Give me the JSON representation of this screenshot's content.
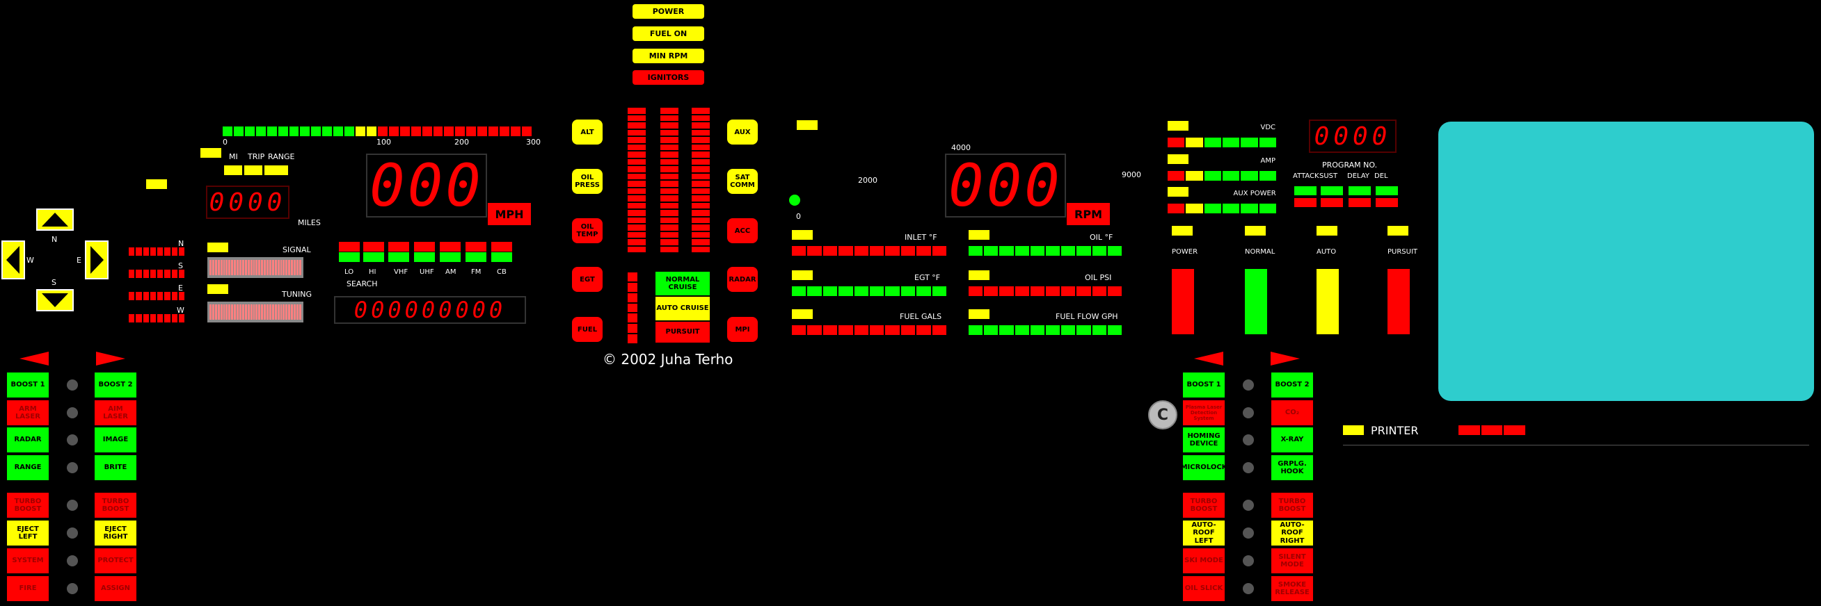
{
  "top_indicators": [
    "POWER",
    "FUEL ON",
    "MIN RPM",
    "IGNITORS"
  ],
  "compass": {
    "n": "N",
    "s": "S",
    "e": "E",
    "w": "W"
  },
  "speed": {
    "scale_labels": [
      "0",
      "100",
      "200",
      "300"
    ],
    "mode_labels": [
      "MI",
      "TRIP",
      "RANGE"
    ],
    "odometer": "0000",
    "miles_label": "MILES",
    "readout": "000",
    "unit": "MPH"
  },
  "nsew_labels": [
    "N",
    "S",
    "E",
    "W"
  ],
  "signal_label": "SIGNAL",
  "tuning_label": "TUNING",
  "bands": [
    "LO",
    "HI",
    "VHF",
    "UHF",
    "AM",
    "FM",
    "CB"
  ],
  "search_label": "SEARCH",
  "freq_readout": "000000000",
  "left_pills": [
    "ALT",
    "OIL PRESS",
    "OIL TEMP",
    "EGT",
    "FUEL"
  ],
  "right_pills": [
    "AUX",
    "SAT COMM",
    "ACC",
    "RADAR",
    "MPI"
  ],
  "cruise_modes": [
    "NORMAL CRUISE",
    "AUTO CRUISE",
    "PURSUIT"
  ],
  "copyright": "© 2002 Juha Terho",
  "rpm": {
    "scale_labels": [
      "0",
      "2000",
      "4000",
      "9000"
    ],
    "readout": "000",
    "unit": "RPM"
  },
  "gauges_left": [
    "INLET °F",
    "EGT °F",
    "FUEL GALS"
  ],
  "gauges_right": [
    "OIL °F",
    "OIL PSI",
    "FUEL FLOW GPH"
  ],
  "power_meters": [
    "VDC",
    "AMP",
    "AUX POWER"
  ],
  "program": {
    "readout": "0000",
    "label": "PROGRAM NO.",
    "columns": [
      "ATTACK",
      "SUST",
      "DELAY",
      "DEL"
    ]
  },
  "mode_columns": [
    "POWER",
    "NORMAL",
    "AUTO",
    "PURSUIT"
  ],
  "left_panel": {
    "col1": [
      "BOOST 1",
      "ARM LASER",
      "RADAR",
      "RANGE",
      "TURBO BOOST",
      "EJECT LEFT",
      "SYSTEM",
      "FIRE"
    ],
    "col2": [
      "BOOST 2",
      "AIM LASER",
      "IMAGE",
      "BRITE",
      "TURBO BOOST",
      "EJECT RIGHT",
      "PROTECT",
      "ASSIGN"
    ]
  },
  "right_panel": {
    "col1": [
      "BOOST 1",
      "Plasma Laser Detection System",
      "HOMING DEVICE",
      "MICROLOCK",
      "TURBO BOOST",
      "AUTO-ROOF LEFT",
      "SKI MODE",
      "OIL SLICK"
    ],
    "col2": [
      "BOOST 2",
      "CO₂",
      "X-RAY",
      "GRPLG. HOOK",
      "TURBO BOOST",
      "AUTO-ROOF RIGHT",
      "SILENT MODE",
      "SMOKE RELEASE"
    ],
    "c_badge": "C"
  },
  "printer_label": "PRINTER",
  "colors": {
    "yellow": "#ffff00",
    "red": "#ff0000",
    "green": "#00ff00",
    "screen": "#2ecdcd"
  }
}
